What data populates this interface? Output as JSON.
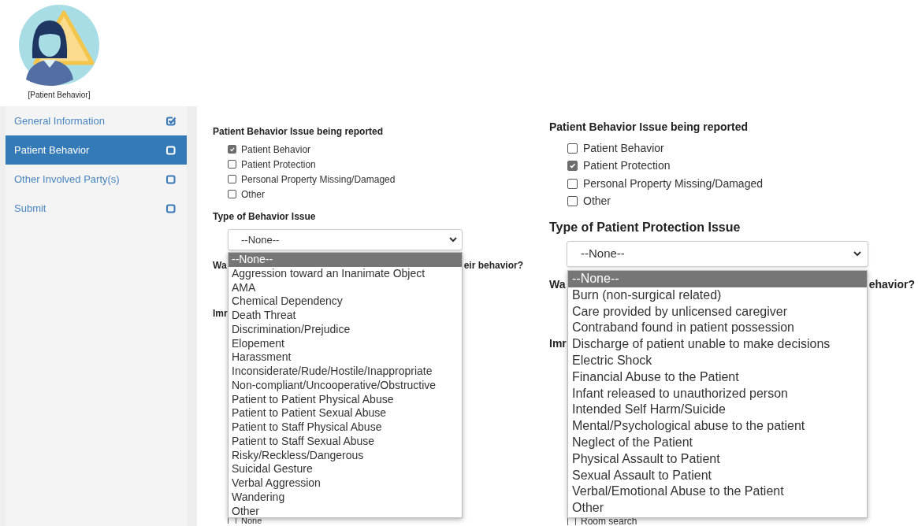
{
  "header": {
    "icon_label": "[Patient Behavior]"
  },
  "sidebar": {
    "items": [
      {
        "label": "General Information",
        "selected": false,
        "completed": true
      },
      {
        "label": "Patient Behavior",
        "selected": true,
        "completed": false
      },
      {
        "label": "Other Involved Party(s)",
        "selected": false,
        "completed": false
      },
      {
        "label": "Submit",
        "selected": false,
        "completed": false
      }
    ]
  },
  "panels": [
    {
      "section_title": "Patient Behavior Issue being reported",
      "issue_options": [
        {
          "label": "Patient Behavior",
          "checked": true
        },
        {
          "label": "Patient Protection",
          "checked": false
        },
        {
          "label": "Personal Property Missing/Damaged",
          "checked": false
        },
        {
          "label": "Other",
          "checked": false
        }
      ],
      "type_label": "Type of Behavior Issue",
      "select": {
        "value": "--None--"
      },
      "question_start": "Wa",
      "question_end": "eir behavior?",
      "next_label": "Imr",
      "bottom_option": {
        "label": "None",
        "checked": false
      },
      "dropdown": {
        "options": [
          {
            "label": "--None--",
            "selected": true
          },
          {
            "label": "Aggression toward an Inanimate Object",
            "selected": false
          },
          {
            "label": "AMA",
            "selected": false
          },
          {
            "label": "Chemical Dependency",
            "selected": false
          },
          {
            "label": "Death Threat",
            "selected": false
          },
          {
            "label": "Discrimination/Prejudice",
            "selected": false
          },
          {
            "label": "Elopement",
            "selected": false
          },
          {
            "label": "Harassment",
            "selected": false
          },
          {
            "label": "Inconsiderate/Rude/Hostile/Inappropriate",
            "selected": false
          },
          {
            "label": "Non-compliant/Uncooperative/Obstructive",
            "selected": false
          },
          {
            "label": "Patient to Patient Physical Abuse",
            "selected": false
          },
          {
            "label": "Patient to Patient Sexual Abuse",
            "selected": false
          },
          {
            "label": "Patient to Staff Physical Abuse",
            "selected": false
          },
          {
            "label": "Patient to Staff Sexual Abuse",
            "selected": false
          },
          {
            "label": "Risky/Reckless/Dangerous",
            "selected": false
          },
          {
            "label": "Suicidal Gesture",
            "selected": false
          },
          {
            "label": "Verbal Aggression",
            "selected": false
          },
          {
            "label": "Wandering",
            "selected": false
          },
          {
            "label": "Other",
            "selected": false
          }
        ]
      }
    },
    {
      "section_title": "Patient Behavior Issue being reported",
      "issue_options": [
        {
          "label": "Patient Behavior",
          "checked": false
        },
        {
          "label": "Patient Protection",
          "checked": true
        },
        {
          "label": "Personal Property Missing/Damaged",
          "checked": false
        },
        {
          "label": "Other",
          "checked": false
        }
      ],
      "type_label": "Type of Patient Protection Issue",
      "select": {
        "value": "--None--"
      },
      "question_start": "Wa",
      "question_end": "ehavior?",
      "next_label": "Imr",
      "bottom_option": {
        "label": "Room search",
        "checked": false
      },
      "dropdown": {
        "options": [
          {
            "label": "--None--",
            "selected": true
          },
          {
            "label": "Burn (non-surgical related)",
            "selected": false
          },
          {
            "label": "Care provided by unlicensed caregiver",
            "selected": false
          },
          {
            "label": "Contraband found in patient possession",
            "selected": false
          },
          {
            "label": "Discharge of patient unable to make decisions",
            "selected": false
          },
          {
            "label": "Electric Shock",
            "selected": false
          },
          {
            "label": "Financial Abuse to the Patient",
            "selected": false
          },
          {
            "label": "Infant released to unauthorized person",
            "selected": false
          },
          {
            "label": "Intended Self Harm/Suicide",
            "selected": false
          },
          {
            "label": "Mental/Psychological abuse to the patient",
            "selected": false
          },
          {
            "label": "Neglect of the Patient",
            "selected": false
          },
          {
            "label": "Physical Assault to Patient",
            "selected": false
          },
          {
            "label": "Sexual Assault to Patient",
            "selected": false
          },
          {
            "label": "Verbal/Emotional Abuse to the Patient",
            "selected": false
          },
          {
            "label": "Other",
            "selected": false
          }
        ]
      }
    }
  ]
}
